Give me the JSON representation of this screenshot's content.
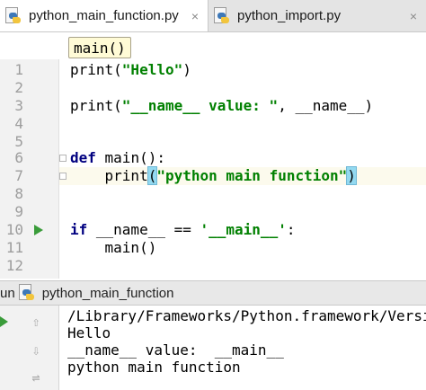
{
  "tabs": [
    {
      "label": "python_main_function.py",
      "close": "×",
      "active": true
    },
    {
      "label": "python_import.py",
      "close": "×",
      "active": false
    }
  ],
  "breadcrumb": "main()",
  "editor": {
    "line_numbers": [
      "1",
      "2",
      "3",
      "4",
      "5",
      "6",
      "7",
      "8",
      "9",
      "10",
      "11",
      "12"
    ],
    "lines": {
      "l1_fn": "print(",
      "l1_str": "\"Hello\"",
      "l1_end": ")",
      "l3_fn": "print(",
      "l3_str": "\"__name__ value: \"",
      "l3_end": ", __name__)",
      "l6_kw": "def",
      "l6_rest": " main():",
      "l7_fn": "    print",
      "l7_open": "(",
      "l7_str": "\"python main function\"",
      "l7_close": ")",
      "l10_kw": "if",
      "l10_mid": " __name__ == ",
      "l10_str": "'__main__'",
      "l10_end": ":",
      "l11": "    main()"
    }
  },
  "run_panel": {
    "label": "un",
    "config_name": "python_main_function",
    "output": [
      "/Library/Frameworks/Python.framework/Versions",
      "Hello",
      "__name__ value:  __main__",
      "python main function"
    ],
    "tools": {
      "up": "⇧",
      "down": "⇩",
      "wrap": "⇌"
    }
  },
  "colors": {
    "keyword": "#000080",
    "string": "#008000",
    "run_green": "#3a9c3a"
  }
}
